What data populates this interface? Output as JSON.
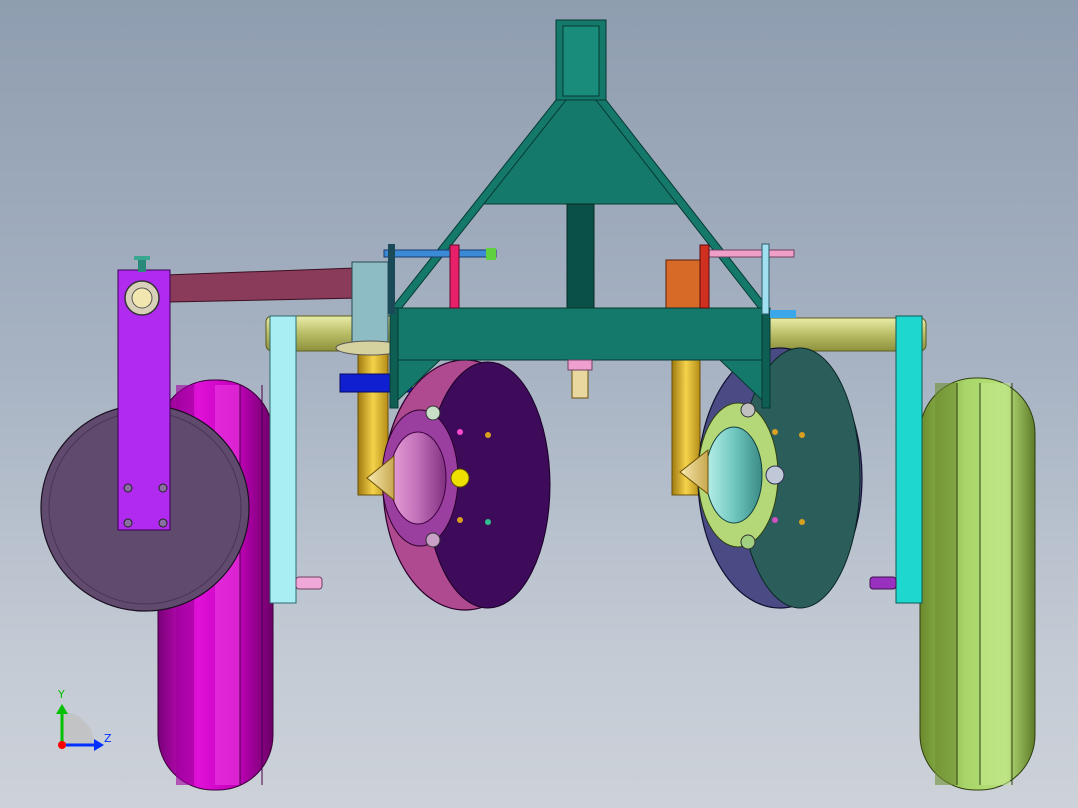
{
  "view": {
    "background_top": "#8f9db0",
    "background_bottom": "#cdd2d9"
  },
  "triad": {
    "y_label": "Y",
    "z_label": "Z",
    "y_color": "#00c000",
    "z_color": "#0030ff",
    "x_color": "#ff0000"
  },
  "colors": {
    "frame": "#14786a",
    "left_wheel": "#d400c8",
    "right_wheel": "#8fbf4a",
    "left_disc": "#7a1f86",
    "right_disc": "#2f6f6a",
    "left_side_wheel": "#604a6e",
    "arm": "#b02af0",
    "bracket": "#7fe6ee",
    "axle": "#c8cc7a",
    "shank": "#e8c23a"
  }
}
